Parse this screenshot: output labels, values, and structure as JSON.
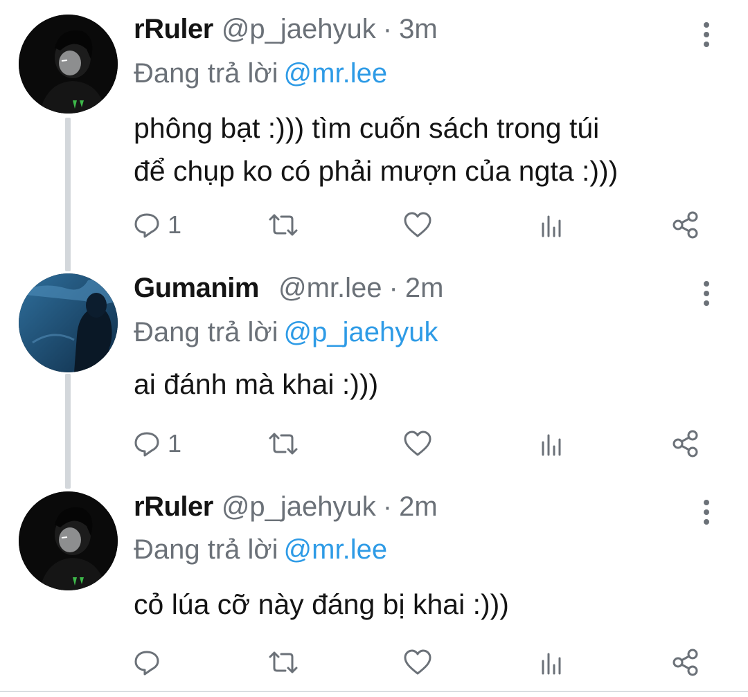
{
  "tweets": [
    {
      "name": "rRuler",
      "handle": "@p_jaehyuk",
      "separator": "·",
      "time": "3m",
      "replying_prefix": "Đang trả lời",
      "replying_to": "@mr.lee",
      "text_lines": [
        "phông bạt :))) tìm cuốn sách trong túi",
        "để chụp ko có phải mượn của ngta :)))"
      ],
      "reply_count": "1",
      "avatar": "dark-portrait-avatar"
    },
    {
      "name": "Gumanim",
      "handle": "@mr.lee",
      "separator": "·",
      "time": "2m",
      "replying_prefix": "Đang trả lời",
      "replying_to": "@p_jaehyuk",
      "text_lines": [
        "ai đánh mà khai :)))"
      ],
      "reply_count": "1",
      "avatar": "blue-silhouette-avatar"
    },
    {
      "name": "rRuler",
      "handle": "@p_jaehyuk",
      "separator": "·",
      "time": "2m",
      "replying_prefix": "Đang trả lời",
      "replying_to": "@mr.lee",
      "text_lines": [
        "cỏ lúa cỡ này đáng bị khai :)))"
      ],
      "reply_count": "",
      "avatar": "dark-portrait-avatar"
    }
  ],
  "icons": {
    "reply": "reply-icon",
    "retweet": "retweet-icon",
    "like": "heart-icon",
    "analytics": "analytics-icon",
    "share": "share-icon",
    "more": "more-vertical-icon"
  },
  "colors": {
    "mention": "#2e9be6",
    "secondary_text": "#6b7178",
    "primary_text": "#141414",
    "thread_line": "#d3d7db"
  }
}
